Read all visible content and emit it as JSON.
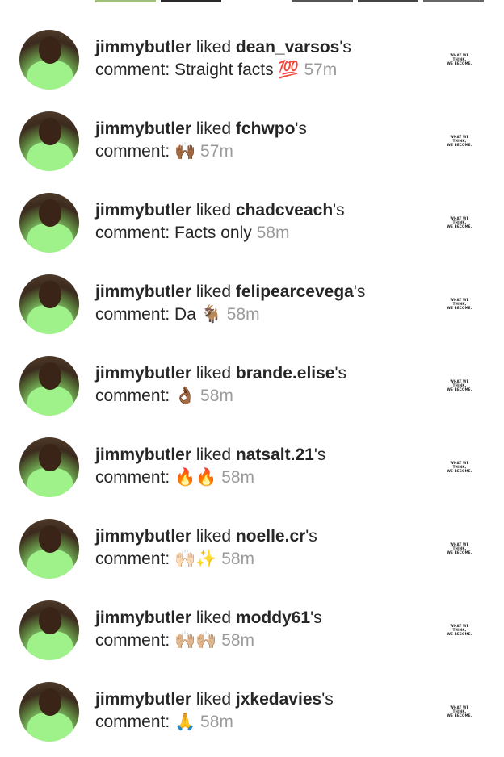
{
  "actor": "jimmybutler",
  "verb": "liked",
  "possessive": "'s",
  "comment_prefix": "comment:",
  "thumbnail_text": [
    "WHAT WE THINK,",
    "WE BECOME."
  ],
  "notifications": [
    {
      "user": "dean_varsos",
      "comment": "Straight facts 💯",
      "time": "57m"
    },
    {
      "user": "fchwpo",
      "comment": "🙌🏾",
      "time": "57m"
    },
    {
      "user": "chadcveach",
      "comment": "Facts only",
      "time": "58m"
    },
    {
      "user": "felipearcevega",
      "comment": "Da 🐐",
      "time": "58m"
    },
    {
      "user": "brande.elise",
      "comment": "👌🏾",
      "time": "58m"
    },
    {
      "user": "natsalt.21",
      "comment": "🔥🔥",
      "time": "58m"
    },
    {
      "user": "noelle.cr",
      "comment": "🙌🏻✨",
      "time": "58m"
    },
    {
      "user": "moddy61",
      "comment": "🙌🏼🙌🏼",
      "time": "58m"
    },
    {
      "user": "jxkedavies",
      "comment": "🙏",
      "time": "58m"
    }
  ],
  "colors": {
    "text": "#262626",
    "timestamp": "#9a9a9a",
    "background": "#ffffff"
  }
}
